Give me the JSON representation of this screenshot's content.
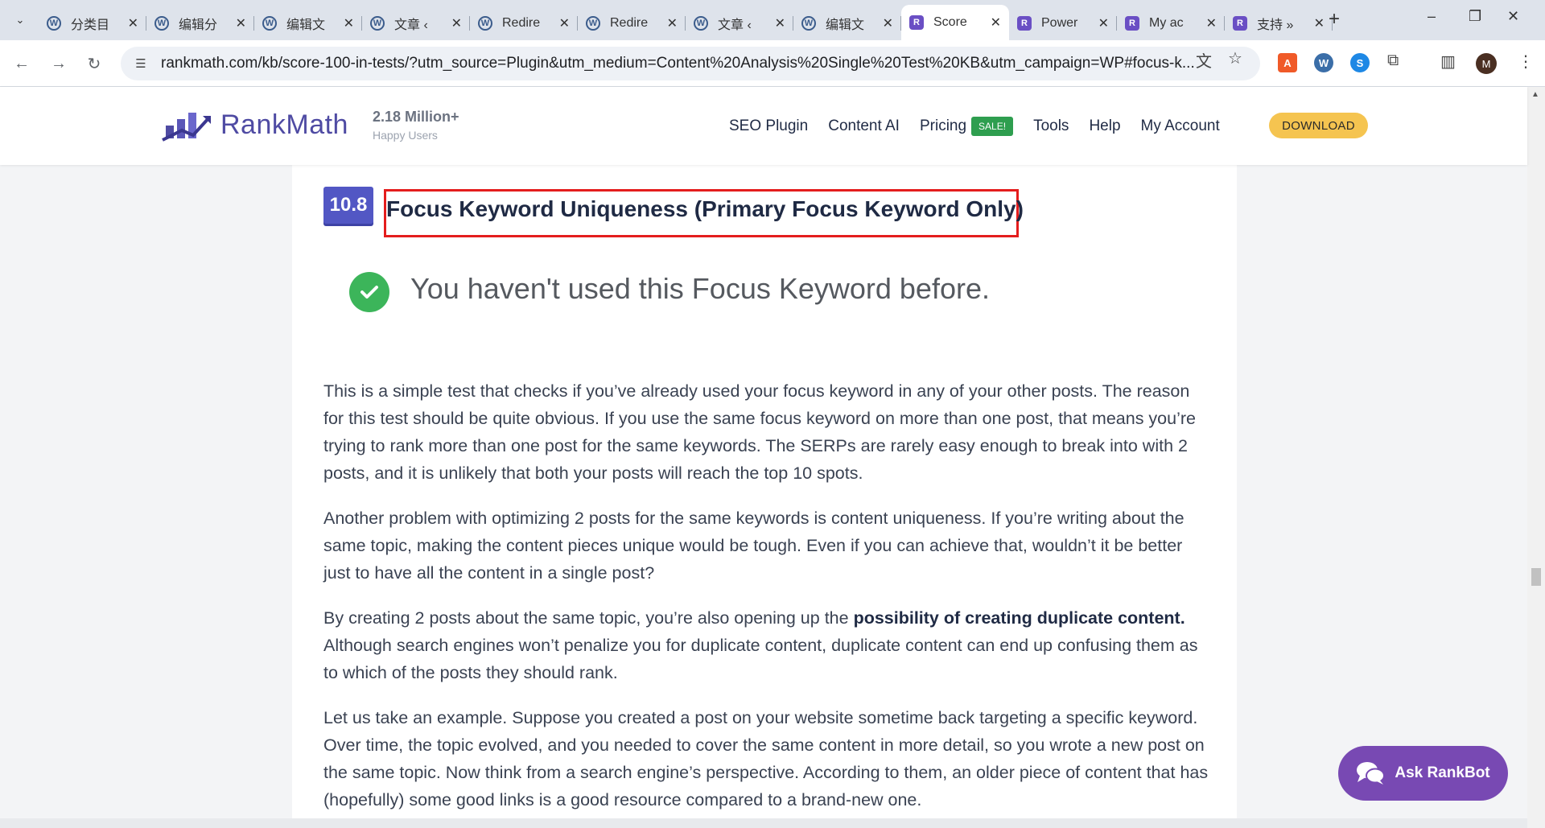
{
  "browser": {
    "tabs": [
      {
        "title": "分类目",
        "icon": "wp"
      },
      {
        "title": "编辑分",
        "icon": "wp"
      },
      {
        "title": "编辑文",
        "icon": "wp"
      },
      {
        "title": "文章 ‹",
        "icon": "wp"
      },
      {
        "title": "Redire",
        "icon": "wp"
      },
      {
        "title": "Redire",
        "icon": "wp"
      },
      {
        "title": "文章 ‹",
        "icon": "wp"
      },
      {
        "title": "编辑文",
        "icon": "wp"
      },
      {
        "title": "Score",
        "icon": "rm",
        "active": true
      },
      {
        "title": "Power",
        "icon": "rm"
      },
      {
        "title": "My ac",
        "icon": "rm"
      },
      {
        "title": "支持 »",
        "icon": "rm"
      }
    ],
    "url_host": "rankmath.com",
    "url_path": "/kb/score-100-in-tests/?utm_source=Plugin&utm_medium=Content%20Analysis%20Single%20Test%20KB&utm_campaign=WP#focus-k...",
    "profile_initial": "M"
  },
  "header": {
    "logo_text": "RankMath",
    "users_count": "2.18 Million+",
    "users_label": "Happy Users",
    "nav": {
      "seo_plugin": "SEO Plugin",
      "content_ai": "Content AI",
      "pricing": "Pricing",
      "sale": "SALE!",
      "tools": "Tools",
      "help": "Help",
      "my_account": "My Account"
    },
    "download_label": "DOWNLOAD"
  },
  "article": {
    "section_number": "10.8",
    "heading": "Focus Keyword Uniqueness (Primary Focus Keyword Only)",
    "check_message": "You haven't used this Focus Keyword before.",
    "paragraphs": {
      "p1": "This is a simple test that checks if you’ve already used your focus keyword in any of your other posts. The reason for this test should be quite obvious. If you use the same focus keyword on more than one post, that means you’re trying to rank more than one post for the same keywords. The SERPs are rarely easy enough to break into with 2 posts, and it is unlikely that both your posts will reach the top 10 spots.",
      "p2": "Another problem with optimizing 2 posts for the same keywords is content uniqueness. If you’re writing about the same topic, making the content pieces unique would be tough. Even if you can achieve that, wouldn’t it be better just to have all the content in a single post?",
      "p3_before": "By creating 2 posts about the same topic, you’re also opening up the ",
      "p3_bold": "possibility of creating duplicate content.",
      "p3_after": " Although search engines won’t penalize you for duplicate content, duplicate content can end up confusing them as to which of the posts they should rank.",
      "p4": "Let us take an example. Suppose you created a post on your website sometime back targeting a specific keyword. Over time, the topic evolved, and you needed to cover the same content in more detail, so you wrote a new post on the same topic. Now think from a search engine’s perspective. According to them, an older piece of content that has (hopefully) some good links is a good resource compared to a brand-new one."
    }
  },
  "rankbot": {
    "label": "Ask RankBot"
  },
  "colors": {
    "brand": "#4f4ba3",
    "section_badge": "#5257c4",
    "highlight_border": "#e41d1d",
    "check_green": "#3cb55a",
    "sale_green": "#2e9e4f",
    "download_yellow": "#f5c450",
    "rankbot_purple": "#7849b3"
  }
}
